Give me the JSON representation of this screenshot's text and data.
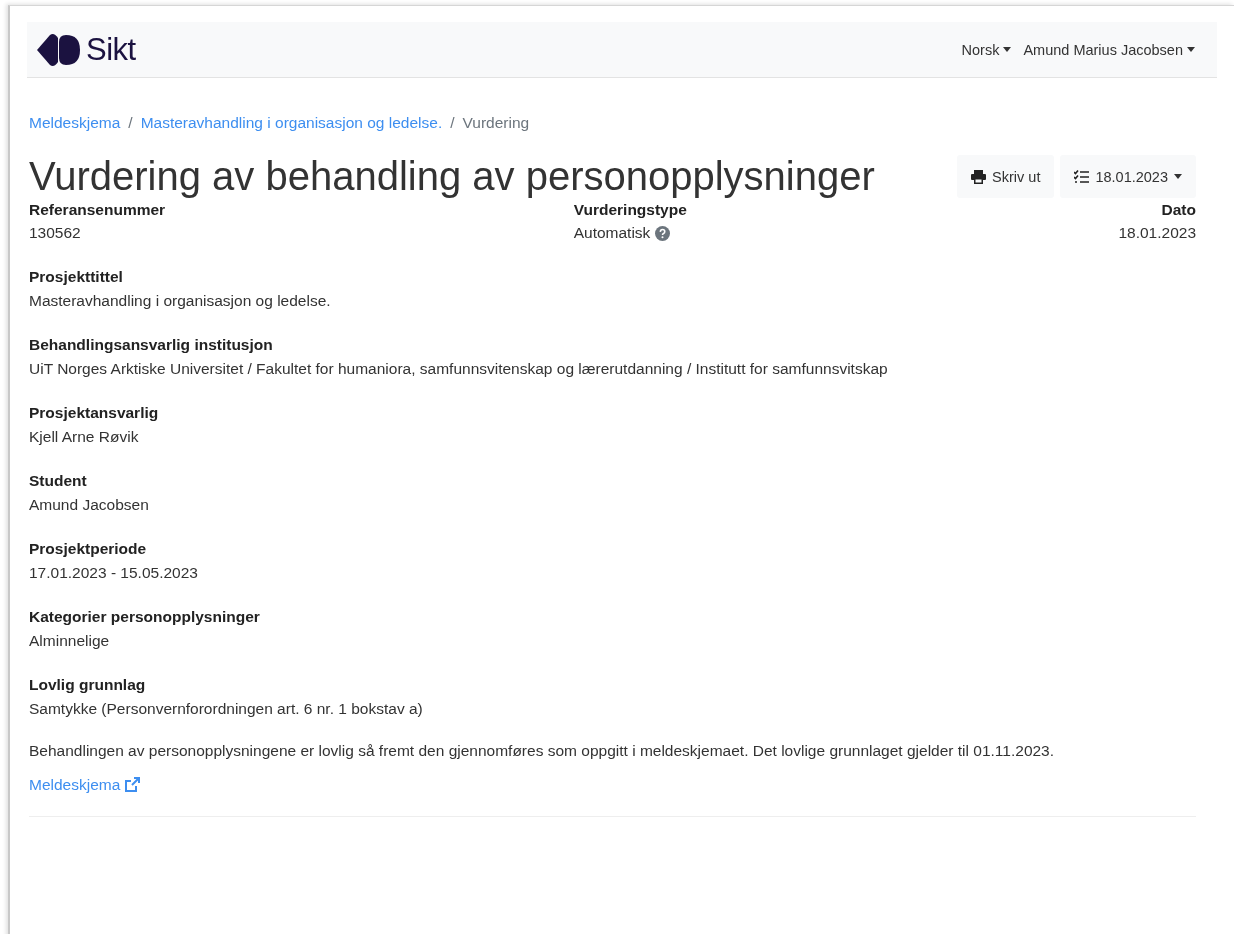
{
  "header": {
    "logo": "Sikt",
    "menus": [
      {
        "label": "Norsk"
      },
      {
        "label": "Amund Marius Jacobsen"
      }
    ]
  },
  "breadcrumb": [
    {
      "label": "Meldeskjema",
      "kind": "link"
    },
    {
      "separator": "/",
      "label": "Masteravhandling i organisasjon og ledelse.",
      "kind": "link"
    },
    {
      "separator": "/",
      "label": "Vurdering",
      "kind": "current"
    }
  ],
  "title": "Vurdering av behandling av personopplysninger",
  "actions": [
    {
      "label": "Skriv ut",
      "kind": "print"
    },
    {
      "label": "18.01.2023",
      "kind": "versions"
    }
  ],
  "summary": [
    {
      "label": "Referansenummer",
      "value": "130562",
      "help": false
    },
    {
      "label": "Vurderingstype",
      "value": "Automatisk",
      "help": true
    },
    {
      "label": "Dato",
      "value": "18.01.2023",
      "help": false
    }
  ],
  "fields": [
    {
      "label": "Prosjekttittel",
      "value": "Masteravhandling i organisasjon og ledelse."
    },
    {
      "label": "Behandlingsansvarlig institusjon",
      "value": "UiT Norges Arktiske Universitet / Fakultet for humaniora, samfunnsvitenskap og lærerutdanning / Institutt for samfunnsvitskap"
    },
    {
      "label": "Prosjektansvarlig",
      "value": "Kjell Arne Røvik"
    },
    {
      "label": "Student",
      "value": "Amund Jacobsen"
    },
    {
      "label": "Prosjektperiode",
      "value": "17.01.2023 - 15.05.2023"
    },
    {
      "label": "Kategorier personopplysninger",
      "value": "Alminnelige"
    },
    {
      "label": "Lovlig grunnlag",
      "value": "Samtykke (Personvernforordningen art. 6 nr. 1 bokstav a)"
    }
  ],
  "note": "Behandlingen av personopplysningene er lovlig så fremt den gjennomføres som oppgitt i meldeskjemaet. Det lovlige grunnlaget gjelder til 01.11.2023.",
  "link": {
    "label": "Meldeskjema"
  }
}
